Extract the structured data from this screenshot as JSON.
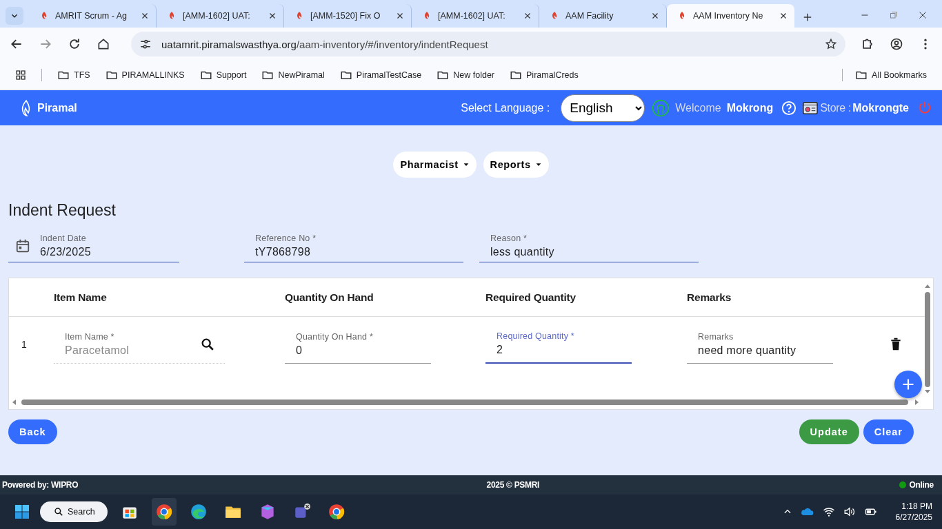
{
  "browser": {
    "tabs": [
      {
        "title": "AMRIT Scrum - Ag",
        "selected": false
      },
      {
        "title": "[AMM-1602] UAT:",
        "selected": false
      },
      {
        "title": "[AMM-1520] Fix O",
        "selected": false
      },
      {
        "title": "[AMM-1602] UAT:",
        "selected": false
      },
      {
        "title": "AAM Facility",
        "selected": false
      },
      {
        "title": "AAM Inventory Ne",
        "selected": true
      }
    ],
    "url_host": "uatamrit.piramalswasthya.org",
    "url_path": "/aam-inventory/#/inventory/indentRequest",
    "bookmarks": [
      "TFS",
      "PIRAMALLINKS",
      "Support",
      "NewPiramal",
      "PiramalTestCase",
      "New folder",
      "PiramalCreds"
    ],
    "all_bookmarks": "All Bookmarks"
  },
  "header": {
    "logo_text": "Piramal",
    "language_label": "Select Language :",
    "language": "English",
    "welcome_label": "Welcome",
    "user": "Mokrong",
    "store_label": "Store :",
    "store": "Mokrongte"
  },
  "menu": [
    "Pharmacist",
    "Reports"
  ],
  "page_title": "Indent Request",
  "form": {
    "fields": [
      {
        "kind": "date",
        "label": "Indent Date",
        "value": "6/23/2025"
      },
      {
        "kind": "text",
        "label": "Reference No *",
        "value": "tY7868798"
      },
      {
        "kind": "text",
        "label": "Reason *",
        "value": "less quantity"
      }
    ]
  },
  "table": {
    "columns": [
      "Item Name",
      "Quantity On Hand",
      "Required Quantity",
      "Remarks"
    ],
    "rows": [
      {
        "index": "1",
        "cells": [
          {
            "kind": "search",
            "label": "Item Name *",
            "value": "Paracetamol",
            "disabled": true,
            "focused": false
          },
          {
            "kind": "text",
            "label": "Quantity On Hand *",
            "value": "0",
            "disabled": false,
            "focused": false
          },
          {
            "kind": "text",
            "label": "Required Quantity *",
            "value": "2",
            "disabled": false,
            "focused": true
          },
          {
            "kind": "text",
            "label": "Remarks",
            "value": "need more quantity",
            "disabled": false,
            "focused": false
          }
        ]
      }
    ]
  },
  "buttons": {
    "back": "Back",
    "update": "Update",
    "clear": "Clear"
  },
  "footer": {
    "powered": "Powered by: WIPRO",
    "copyright": "2025 © PSMRI",
    "status": "Online"
  },
  "taskbar": {
    "search": "Search",
    "time": "1:18 PM",
    "date": "6/27/2025"
  }
}
